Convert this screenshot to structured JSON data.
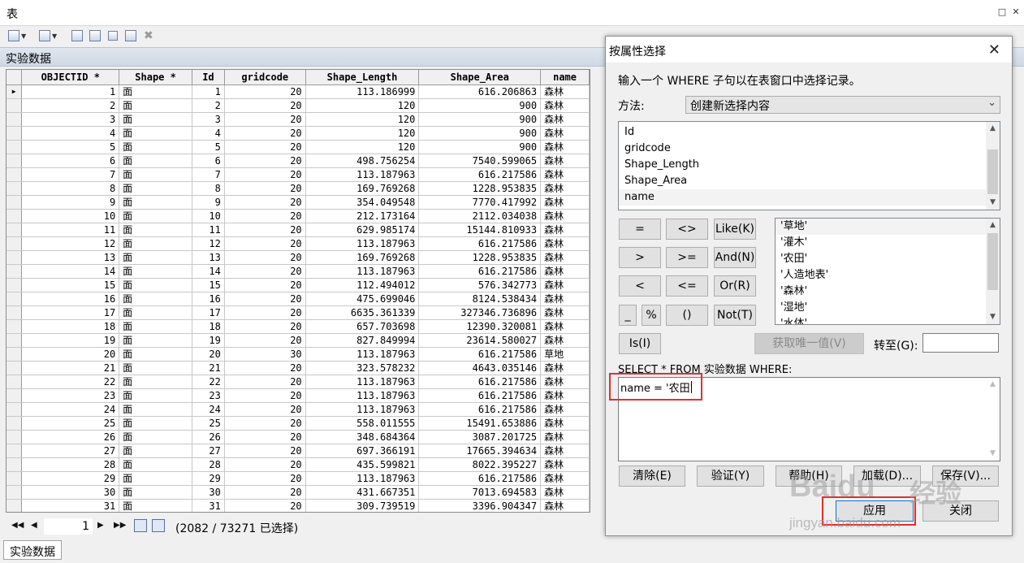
{
  "window": {
    "title": "表"
  },
  "table": {
    "caption": "实验数据",
    "columns": [
      {
        "key": "objectid",
        "label": "OBJECTID *"
      },
      {
        "key": "shape",
        "label": "Shape *"
      },
      {
        "key": "id",
        "label": "Id"
      },
      {
        "key": "gridcode",
        "label": "gridcode"
      },
      {
        "key": "shape_length",
        "label": "Shape_Length"
      },
      {
        "key": "shape_area",
        "label": "Shape_Area"
      },
      {
        "key": "name",
        "label": "name"
      }
    ],
    "rows": [
      [
        "1",
        "面",
        "1",
        "20",
        "113.186999",
        "616.206863",
        "森林"
      ],
      [
        "2",
        "面",
        "2",
        "20",
        "120",
        "900",
        "森林"
      ],
      [
        "3",
        "面",
        "3",
        "20",
        "120",
        "900",
        "森林"
      ],
      [
        "4",
        "面",
        "4",
        "20",
        "120",
        "900",
        "森林"
      ],
      [
        "5",
        "面",
        "5",
        "20",
        "120",
        "900",
        "森林"
      ],
      [
        "6",
        "面",
        "6",
        "20",
        "498.756254",
        "7540.599065",
        "森林"
      ],
      [
        "7",
        "面",
        "7",
        "20",
        "113.187963",
        "616.217586",
        "森林"
      ],
      [
        "8",
        "面",
        "8",
        "20",
        "169.769268",
        "1228.953835",
        "森林"
      ],
      [
        "9",
        "面",
        "9",
        "20",
        "354.049548",
        "7770.417992",
        "森林"
      ],
      [
        "10",
        "面",
        "10",
        "20",
        "212.173164",
        "2112.034038",
        "森林"
      ],
      [
        "11",
        "面",
        "11",
        "20",
        "629.985174",
        "15144.810933",
        "森林"
      ],
      [
        "12",
        "面",
        "12",
        "20",
        "113.187963",
        "616.217586",
        "森林"
      ],
      [
        "13",
        "面",
        "13",
        "20",
        "169.769268",
        "1228.953835",
        "森林"
      ],
      [
        "14",
        "面",
        "14",
        "20",
        "113.187963",
        "616.217586",
        "森林"
      ],
      [
        "15",
        "面",
        "15",
        "20",
        "112.494012",
        "576.342773",
        "森林"
      ],
      [
        "16",
        "面",
        "16",
        "20",
        "475.699046",
        "8124.538434",
        "森林"
      ],
      [
        "17",
        "面",
        "17",
        "20",
        "6635.361339",
        "327346.736896",
        "森林"
      ],
      [
        "18",
        "面",
        "18",
        "20",
        "657.703698",
        "12390.320081",
        "森林"
      ],
      [
        "19",
        "面",
        "19",
        "20",
        "827.849994",
        "23614.580027",
        "森林"
      ],
      [
        "20",
        "面",
        "20",
        "30",
        "113.187963",
        "616.217586",
        "草地"
      ],
      [
        "21",
        "面",
        "21",
        "20",
        "323.578232",
        "4643.035146",
        "森林"
      ],
      [
        "22",
        "面",
        "22",
        "20",
        "113.187963",
        "616.217586",
        "森林"
      ],
      [
        "23",
        "面",
        "23",
        "20",
        "113.187963",
        "616.217586",
        "森林"
      ],
      [
        "24",
        "面",
        "24",
        "20",
        "113.187963",
        "616.217586",
        "森林"
      ],
      [
        "25",
        "面",
        "25",
        "20",
        "558.011555",
        "15491.653886",
        "森林"
      ],
      [
        "26",
        "面",
        "26",
        "20",
        "348.684364",
        "3087.201725",
        "森林"
      ],
      [
        "27",
        "面",
        "27",
        "20",
        "697.366191",
        "17665.394634",
        "森林"
      ],
      [
        "28",
        "面",
        "28",
        "20",
        "435.599821",
        "8022.395227",
        "森林"
      ],
      [
        "29",
        "面",
        "29",
        "20",
        "113.187963",
        "616.217586",
        "森林"
      ],
      [
        "30",
        "面",
        "30",
        "20",
        "431.667351",
        "7013.694583",
        "森林"
      ],
      [
        "31",
        "面",
        "31",
        "20",
        "309.739519",
        "3396.904347",
        "森林"
      ]
    ]
  },
  "navbar": {
    "record": "1",
    "status": "(2082 / 73271 已选择)"
  },
  "bottom_tab": "实验数据",
  "dialog": {
    "title": "按属性选择",
    "instruction": "输入一个 WHERE 子句以在表窗口中选择记录。",
    "method_label": "方法:",
    "method_value": "创建新选择内容",
    "fields": [
      "Id",
      "gridcode",
      "Shape_Length",
      "Shape_Area",
      "name"
    ],
    "values": [
      "'草地'",
      "'灌木'",
      "'农田'",
      "'人造地表'",
      "'森林'",
      "'湿地'",
      "'水体'"
    ],
    "operators": [
      "=",
      "<>",
      "Like(K)",
      ">",
      ">=",
      "And(N)",
      "<",
      "<=",
      "Or(R)",
      "_",
      "%",
      "()",
      "Not(T)"
    ],
    "is_label": "Is(I)",
    "get_unique_label": "获取唯一值(V)",
    "goto_label": "转至(G):",
    "goto_value": "",
    "select_clause": "SELECT * FROM 实验数据 WHERE:",
    "where_value": "name = '农田'",
    "buttons": {
      "clear": "清除(E)",
      "verify": "验证(Y)",
      "help": "帮助(H)",
      "load": "加载(D)...",
      "save": "保存(V)...",
      "apply": "应用",
      "close": "关闭"
    }
  },
  "watermark": {
    "brand": "Baidu",
    "text": "经验",
    "url": "jingyan.baidu.com"
  },
  "colors": {
    "highlight_red": "#e0302a",
    "caption_band": "#d4dce7",
    "focus_blue": "#0078d7"
  }
}
